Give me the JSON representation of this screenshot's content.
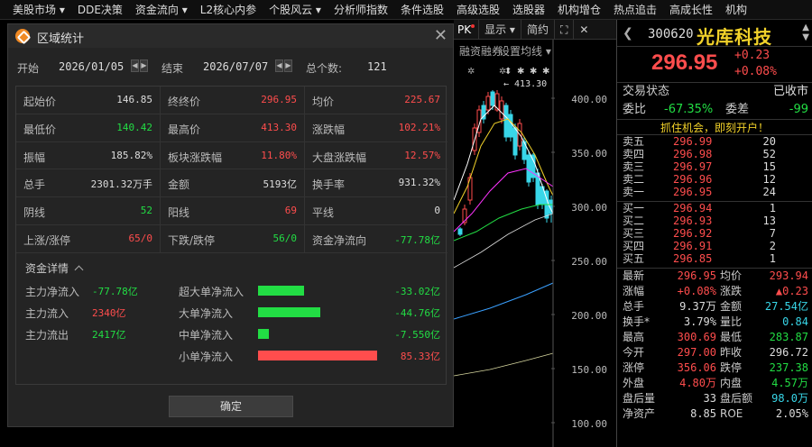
{
  "menu": [
    "美股市场 ▾",
    "DDE决策",
    "资金流向 ▾",
    "L2核心内参",
    "个股风云 ▾",
    "分析师指数",
    "条件选股",
    "高级选股",
    "选股器",
    "机构增仓",
    "热点追击",
    "高成长性",
    "机构"
  ],
  "chart": {
    "toolbar": [
      "PK",
      "显示 ▾",
      "简约",
      "⛶",
      "✕"
    ],
    "sub_left": "融资融券",
    "sub_right": "设置均线 ▾",
    "high_label": "413.30",
    "y_ticks": [
      "400.00",
      "350.00",
      "300.00",
      "250.00",
      "200.00",
      "150.00",
      "100.00"
    ],
    "colors": {
      "up": "#ff4d4d",
      "down": "#38d6e8",
      "ma5": "#ffffff",
      "ma10": "#f2d22a",
      "ma20": "#ff33ff",
      "ma60": "#22dd44",
      "ma120": "#3aa0ff"
    }
  },
  "quote": {
    "code": "300620",
    "name": "光库科技",
    "price": "296.95",
    "change": "+0.23",
    "change_pct": "+0.08%",
    "trade_status_label": "交易状态",
    "trade_status": "已收市",
    "weibi_label": "委比",
    "weibi": "-67.35%",
    "weicha_label": "委差",
    "weicha": "-99",
    "promo": "抓住机会，即刻开户！",
    "asks": [
      {
        "label": "卖五",
        "price": "296.99",
        "vol": "20"
      },
      {
        "label": "卖四",
        "price": "296.98",
        "vol": "52"
      },
      {
        "label": "卖三",
        "price": "296.97",
        "vol": "15"
      },
      {
        "label": "卖二",
        "price": "296.96",
        "vol": "12"
      },
      {
        "label": "卖一",
        "price": "296.95",
        "vol": "24"
      }
    ],
    "bids": [
      {
        "label": "买一",
        "price": "296.94",
        "vol": "1"
      },
      {
        "label": "买二",
        "price": "296.93",
        "vol": "13"
      },
      {
        "label": "买三",
        "price": "296.92",
        "vol": "7"
      },
      {
        "label": "买四",
        "price": "296.91",
        "vol": "2"
      },
      {
        "label": "买五",
        "price": "296.85",
        "vol": "1"
      }
    ],
    "stats": [
      {
        "a": "最新",
        "b": "296.95",
        "bc": "red",
        "c": "均价",
        "d": "293.94",
        "dc": "red"
      },
      {
        "a": "涨幅",
        "b": "+0.08%",
        "bc": "red",
        "c": "涨跌",
        "d": "▲0.23",
        "dc": "red"
      },
      {
        "a": "总手",
        "b": "9.37万",
        "bc": "white",
        "c": "金额",
        "d": "27.54亿",
        "dc": "cyan"
      },
      {
        "a": "换手*",
        "b": "3.79%",
        "bc": "white",
        "c": "量比",
        "d": "0.84",
        "dc": "cyan"
      },
      {
        "a": "最高",
        "b": "300.69",
        "bc": "red",
        "c": "最低",
        "d": "283.87",
        "dc": "green"
      },
      {
        "a": "今开",
        "b": "297.00",
        "bc": "red",
        "c": "昨收",
        "d": "296.72",
        "dc": "white"
      },
      {
        "a": "涨停",
        "b": "356.06",
        "bc": "red",
        "c": "跌停",
        "d": "237.38",
        "dc": "green"
      },
      {
        "a": "外盘",
        "b": "4.80万",
        "bc": "red",
        "c": "内盘",
        "d": "4.57万",
        "dc": "green"
      },
      {
        "a": "盘后量",
        "b": "33",
        "bc": "white",
        "c": "盘后额",
        "d": "98.0万",
        "dc": "cyan"
      },
      {
        "a": "净资产",
        "b": "8.85",
        "bc": "white",
        "c": "ROE",
        "d": "2.05%",
        "dc": "white"
      }
    ]
  },
  "dialog": {
    "title": "区域统计",
    "start_label": "开始",
    "start": "2026/01/05",
    "end_label": "结束",
    "end": "2026/07/07",
    "count_label": "总个数:",
    "count": "121",
    "cells": [
      {
        "k": "起始价",
        "v": "146.85",
        "c": "white"
      },
      {
        "k": "终终价",
        "v": "296.95",
        "c": "red"
      },
      {
        "k": "均价",
        "v": "225.67",
        "c": "red"
      },
      {
        "k": "最低价",
        "v": "140.42",
        "c": "green"
      },
      {
        "k": "最高价",
        "v": "413.30",
        "c": "red"
      },
      {
        "k": "涨跌幅",
        "v": "102.21%",
        "c": "red"
      },
      {
        "k": "振幅",
        "v": "185.82%",
        "c": "white"
      },
      {
        "k": "板块涨跌幅",
        "v": "11.80%",
        "c": "red"
      },
      {
        "k": "大盘涨跌幅",
        "v": "12.57%",
        "c": "red"
      },
      {
        "k": "总手",
        "v": "2301.32万手",
        "c": "white"
      },
      {
        "k": "金额",
        "v": "5193亿",
        "c": "white"
      },
      {
        "k": "换手率",
        "v": "931.32%",
        "c": "white"
      },
      {
        "k": "阴线",
        "v": "52",
        "c": "green"
      },
      {
        "k": "阳线",
        "v": "69",
        "c": "red"
      },
      {
        "k": "平线",
        "v": "0",
        "c": "white"
      },
      {
        "k": "上涨/涨停",
        "v": "65/0",
        "c": "red"
      },
      {
        "k": "下跌/跌停",
        "v": "56/0",
        "c": "green"
      },
      {
        "k": "资金净流向",
        "v": "-77.78亿",
        "c": "green"
      }
    ],
    "funds_title": "资金详情",
    "main_flows": [
      {
        "k": "主力净流入",
        "v": "-77.78亿",
        "c": "green"
      },
      {
        "k": "主力流入",
        "v": "2340亿",
        "c": "red"
      },
      {
        "k": "主力流出",
        "v": "2417亿",
        "c": "green"
      }
    ],
    "order_flows": [
      {
        "k": "超大单净流入",
        "v": "-33.02亿",
        "c": "green",
        "amount": -33.02
      },
      {
        "k": "大单净流入",
        "v": "-44.76亿",
        "c": "green",
        "amount": -44.76
      },
      {
        "k": "中单净流入",
        "v": "-7.550亿",
        "c": "green",
        "amount": -7.55
      },
      {
        "k": "小单净流入",
        "v": "85.33亿",
        "c": "red",
        "amount": 85.33
      }
    ],
    "ok_label": "确定"
  }
}
